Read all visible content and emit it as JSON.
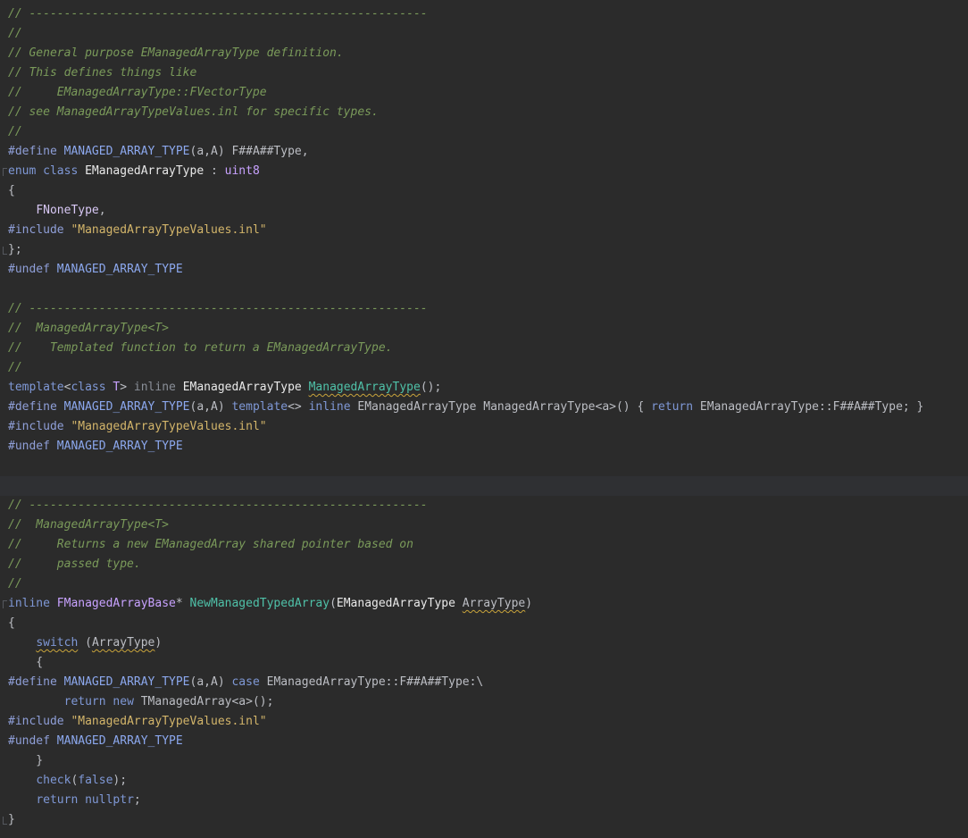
{
  "editor": {
    "theme_colors": {
      "background": "#2b2b2b",
      "comment": "#7a9a5a",
      "preprocessor": "#8f9fd8",
      "keyword": "#7f98d6",
      "type": "#c8a2ff",
      "string": "#d3b56a",
      "function": "#4fc1a8",
      "text": "#bcbec4"
    },
    "lines": [
      {
        "tokens": [
          {
            "t": "// ---------------------------------------------------------",
            "c": "comment"
          }
        ]
      },
      {
        "tokens": [
          {
            "t": "//",
            "c": "comment"
          }
        ]
      },
      {
        "tokens": [
          {
            "t": "// General purpose EManagedArrayType definition.",
            "c": "comment"
          }
        ]
      },
      {
        "tokens": [
          {
            "t": "// This defines things like",
            "c": "comment"
          }
        ]
      },
      {
        "tokens": [
          {
            "t": "//     EManagedArrayType::FVectorType",
            "c": "comment"
          }
        ]
      },
      {
        "tokens": [
          {
            "t": "// see ManagedArrayTypeValues.inl for specific types.",
            "c": "comment"
          }
        ]
      },
      {
        "tokens": [
          {
            "t": "//",
            "c": "comment"
          }
        ]
      },
      {
        "tokens": [
          {
            "t": "#define ",
            "c": "pre"
          },
          {
            "t": "MANAGED_ARRAY_TYPE",
            "c": "macro"
          },
          {
            "t": "(a,A) F##A##Type,",
            "c": "plain"
          }
        ]
      },
      {
        "fold": "start",
        "tokens": [
          {
            "t": "enum ",
            "c": "kw"
          },
          {
            "t": "class ",
            "c": "kw"
          },
          {
            "t": "EManagedArrayType",
            "c": "cls"
          },
          {
            "t": " : ",
            "c": "plain"
          },
          {
            "t": "uint8",
            "c": "type"
          }
        ]
      },
      {
        "tokens": [
          {
            "t": "{",
            "c": "plain"
          }
        ]
      },
      {
        "tokens": [
          {
            "t": "    ",
            "c": "plain"
          },
          {
            "t": "FNoneType",
            "c": "enum"
          },
          {
            "t": ",",
            "c": "plain"
          }
        ]
      },
      {
        "tokens": [
          {
            "t": "#include ",
            "c": "pre"
          },
          {
            "t": "\"ManagedArrayTypeValues.inl\"",
            "c": "str"
          }
        ]
      },
      {
        "fold": "end",
        "tokens": [
          {
            "t": "};",
            "c": "plain"
          }
        ]
      },
      {
        "tokens": [
          {
            "t": "#undef ",
            "c": "pre"
          },
          {
            "t": "MANAGED_ARRAY_TYPE",
            "c": "macro"
          }
        ]
      },
      {
        "tokens": []
      },
      {
        "tokens": [
          {
            "t": "// ---------------------------------------------------------",
            "c": "comment"
          }
        ]
      },
      {
        "tokens": [
          {
            "t": "//  ManagedArrayType<T>",
            "c": "comment"
          }
        ]
      },
      {
        "tokens": [
          {
            "t": "//    Templated function to return a EManagedArrayType.",
            "c": "comment"
          }
        ]
      },
      {
        "tokens": [
          {
            "t": "//",
            "c": "comment"
          }
        ]
      },
      {
        "tokens": [
          {
            "t": "template",
            "c": "kw"
          },
          {
            "t": "<",
            "c": "plain"
          },
          {
            "t": "class ",
            "c": "kw"
          },
          {
            "t": "T",
            "c": "type"
          },
          {
            "t": "> ",
            "c": "plain"
          },
          {
            "t": "inline ",
            "c": "muted"
          },
          {
            "t": "EManagedArrayType ",
            "c": "cls"
          },
          {
            "t": "ManagedArrayType",
            "c": "fn",
            "wavy": true
          },
          {
            "t": "();",
            "c": "plain"
          }
        ]
      },
      {
        "tokens": [
          {
            "t": "#define ",
            "c": "pre"
          },
          {
            "t": "MANAGED_ARRAY_TYPE",
            "c": "macro"
          },
          {
            "t": "(a,A) ",
            "c": "plain"
          },
          {
            "t": "template",
            "c": "kw"
          },
          {
            "t": "<> ",
            "c": "plain"
          },
          {
            "t": "inline ",
            "c": "kw"
          },
          {
            "t": "EManagedArrayType ManagedArrayType<a>() { ",
            "c": "plain"
          },
          {
            "t": "return ",
            "c": "kw"
          },
          {
            "t": "EManagedArrayType::F##A##Type; }",
            "c": "plain"
          }
        ]
      },
      {
        "tokens": [
          {
            "t": "#include ",
            "c": "pre"
          },
          {
            "t": "\"ManagedArrayTypeValues.inl\"",
            "c": "str"
          }
        ]
      },
      {
        "tokens": [
          {
            "t": "#undef ",
            "c": "pre"
          },
          {
            "t": "MANAGED_ARRAY_TYPE",
            "c": "macro"
          }
        ]
      },
      {
        "tokens": []
      },
      {
        "highlight": true,
        "tokens": []
      },
      {
        "tokens": [
          {
            "t": "// ---------------------------------------------------------",
            "c": "comment"
          }
        ]
      },
      {
        "tokens": [
          {
            "t": "//  ManagedArrayType<T>",
            "c": "comment"
          }
        ]
      },
      {
        "tokens": [
          {
            "t": "//     Returns a new EManagedArray shared pointer based on",
            "c": "comment"
          }
        ]
      },
      {
        "tokens": [
          {
            "t": "//     passed type.",
            "c": "comment"
          }
        ]
      },
      {
        "tokens": [
          {
            "t": "//",
            "c": "comment"
          }
        ]
      },
      {
        "fold": "start",
        "tokens": [
          {
            "t": "inline ",
            "c": "kw"
          },
          {
            "t": "FManagedArrayBase",
            "c": "type"
          },
          {
            "t": "* ",
            "c": "plain"
          },
          {
            "t": "NewManagedTypedArray",
            "c": "fn"
          },
          {
            "t": "(",
            "c": "plain"
          },
          {
            "t": "EManagedArrayType ",
            "c": "cls"
          },
          {
            "t": "ArrayType",
            "c": "param",
            "wavy": true
          },
          {
            "t": ")",
            "c": "plain"
          }
        ]
      },
      {
        "tokens": [
          {
            "t": "{",
            "c": "plain"
          }
        ]
      },
      {
        "tokens": [
          {
            "t": "    ",
            "c": "plain"
          },
          {
            "t": "switch",
            "c": "kw",
            "wavy": true
          },
          {
            "t": " (",
            "c": "plain"
          },
          {
            "t": "ArrayType",
            "c": "param",
            "wavy": true
          },
          {
            "t": ")",
            "c": "plain"
          }
        ]
      },
      {
        "tokens": [
          {
            "t": "    {",
            "c": "plain"
          }
        ]
      },
      {
        "tokens": [
          {
            "t": "#define ",
            "c": "pre"
          },
          {
            "t": "MANAGED_ARRAY_TYPE",
            "c": "macro"
          },
          {
            "t": "(a,A) ",
            "c": "plain"
          },
          {
            "t": "case ",
            "c": "kw"
          },
          {
            "t": "EManagedArrayType::F##A##Type:\\",
            "c": "plain"
          }
        ]
      },
      {
        "tokens": [
          {
            "t": "        ",
            "c": "plain"
          },
          {
            "t": "return ",
            "c": "kw"
          },
          {
            "t": "new ",
            "c": "kw"
          },
          {
            "t": "TManagedArray<a>();",
            "c": "plain"
          }
        ]
      },
      {
        "tokens": [
          {
            "t": "#include ",
            "c": "pre"
          },
          {
            "t": "\"ManagedArrayTypeValues.inl\"",
            "c": "str"
          }
        ]
      },
      {
        "tokens": [
          {
            "t": "#undef ",
            "c": "pre"
          },
          {
            "t": "MANAGED_ARRAY_TYPE",
            "c": "macro"
          }
        ]
      },
      {
        "tokens": [
          {
            "t": "    }",
            "c": "plain"
          }
        ]
      },
      {
        "tokens": [
          {
            "t": "    ",
            "c": "plain"
          },
          {
            "t": "check",
            "c": "fn2"
          },
          {
            "t": "(",
            "c": "plain"
          },
          {
            "t": "false",
            "c": "kw"
          },
          {
            "t": ");",
            "c": "plain"
          }
        ]
      },
      {
        "tokens": [
          {
            "t": "    ",
            "c": "plain"
          },
          {
            "t": "return ",
            "c": "kw"
          },
          {
            "t": "nullptr",
            "c": "kw"
          },
          {
            "t": ";",
            "c": "plain"
          }
        ]
      },
      {
        "fold": "end",
        "tokens": [
          {
            "t": "}",
            "c": "plain"
          }
        ]
      }
    ]
  }
}
